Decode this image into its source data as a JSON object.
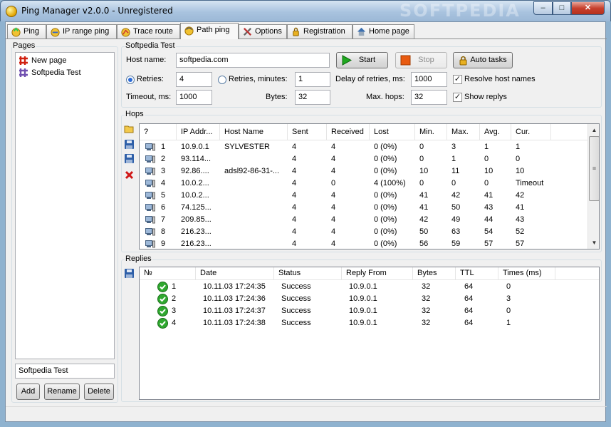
{
  "window": {
    "title": "Ping Manager v2.0.0 - Unregistered",
    "watermark": "SOFTPEDIA",
    "min_glyph": "–",
    "max_glyph": "□",
    "close_glyph": "✕"
  },
  "tabs": [
    {
      "label": "Ping",
      "icon": "ping-icon"
    },
    {
      "label": "IP range ping",
      "icon": "ip-range-icon"
    },
    {
      "label": "Trace route",
      "icon": "trace-route-icon"
    },
    {
      "label": "Path ping",
      "icon": "path-ping-icon",
      "active": true
    },
    {
      "label": "Options",
      "icon": "options-icon"
    },
    {
      "label": "Registration",
      "icon": "registration-icon"
    },
    {
      "label": "Home page",
      "icon": "home-icon"
    }
  ],
  "pages": {
    "label": "Pages",
    "items": [
      {
        "label": "New page",
        "icon": "new-page-icon"
      },
      {
        "label": "Softpedia Test",
        "icon": "page-icon"
      }
    ],
    "name_value": "Softpedia Test",
    "add_label": "Add",
    "rename_label": "Rename",
    "delete_label": "Delete"
  },
  "settings": {
    "group_label": "Softpedia Test",
    "host_label": "Host name:",
    "host_value": "softpedia.com",
    "start_label": "Start",
    "stop_label": "Stop",
    "auto_label": "Auto tasks",
    "retries_label": "Retries:",
    "retries_value": "4",
    "retries_minutes_label": "Retries, minutes:",
    "retries_minutes_value": "1",
    "delay_label": "Delay of retries, ms:",
    "delay_value": "1000",
    "resolve_label": "Resolve host names",
    "timeout_label": "Timeout, ms:",
    "timeout_value": "1000",
    "bytes_label": "Bytes:",
    "bytes_value": "32",
    "maxhops_label": "Max. hops:",
    "maxhops_value": "32",
    "show_replys_label": "Show replys",
    "check_glyph": "✓"
  },
  "hops": {
    "label": "Hops",
    "columns": [
      "?",
      "IP Addr...",
      "Host Name",
      "Sent",
      "Received",
      "Lost",
      "Min.",
      "Max.",
      "Avg.",
      "Cur."
    ],
    "rows": [
      [
        "1",
        "10.9.0.1",
        "SYLVESTER",
        "4",
        "4",
        "0 (0%)",
        "0",
        "3",
        "1",
        "1"
      ],
      [
        "2",
        "93.114...",
        "",
        "4",
        "4",
        "0 (0%)",
        "0",
        "1",
        "0",
        "0"
      ],
      [
        "3",
        "92.86....",
        "adsl92-86-31-...",
        "4",
        "4",
        "0 (0%)",
        "10",
        "11",
        "10",
        "10"
      ],
      [
        "4",
        "10.0.2...",
        "",
        "4",
        "0",
        "4 (100%)",
        "0",
        "0",
        "0",
        "Timeout"
      ],
      [
        "5",
        "10.0.2...",
        "",
        "4",
        "4",
        "0 (0%)",
        "41",
        "42",
        "41",
        "42"
      ],
      [
        "6",
        "74.125...",
        "",
        "4",
        "4",
        "0 (0%)",
        "41",
        "50",
        "43",
        "41"
      ],
      [
        "7",
        "209.85...",
        "",
        "4",
        "4",
        "0 (0%)",
        "42",
        "49",
        "44",
        "43"
      ],
      [
        "8",
        "216.23...",
        "",
        "4",
        "4",
        "0 (0%)",
        "50",
        "63",
        "54",
        "52"
      ],
      [
        "9",
        "216.23...",
        "",
        "4",
        "4",
        "0 (0%)",
        "56",
        "59",
        "57",
        "57"
      ]
    ]
  },
  "replies": {
    "label": "Replies",
    "columns": [
      "№",
      "Date",
      "Status",
      "Reply From",
      "Bytes",
      "TTL",
      "Times (ms)"
    ],
    "rows": [
      [
        "1",
        "10.11.03  17:24:35",
        "Success",
        "10.9.0.1",
        "32",
        "64",
        "0"
      ],
      [
        "2",
        "10.11.03  17:24:36",
        "Success",
        "10.9.0.1",
        "32",
        "64",
        "3"
      ],
      [
        "3",
        "10.11.03  17:24:37",
        "Success",
        "10.9.0.1",
        "32",
        "64",
        "0"
      ],
      [
        "4",
        "10.11.03  17:24:38",
        "Success",
        "10.9.0.1",
        "32",
        "64",
        "1"
      ]
    ]
  },
  "scroll": {
    "up_glyph": "▲",
    "down_glyph": "▼",
    "grip_glyph": "≡"
  },
  "colors": {
    "accent": "#2c6bd6",
    "start_green": "#1fa81f",
    "stop_orange": "#e85a10",
    "success_green": "#2fa82f",
    "delete_red": "#d01818"
  }
}
